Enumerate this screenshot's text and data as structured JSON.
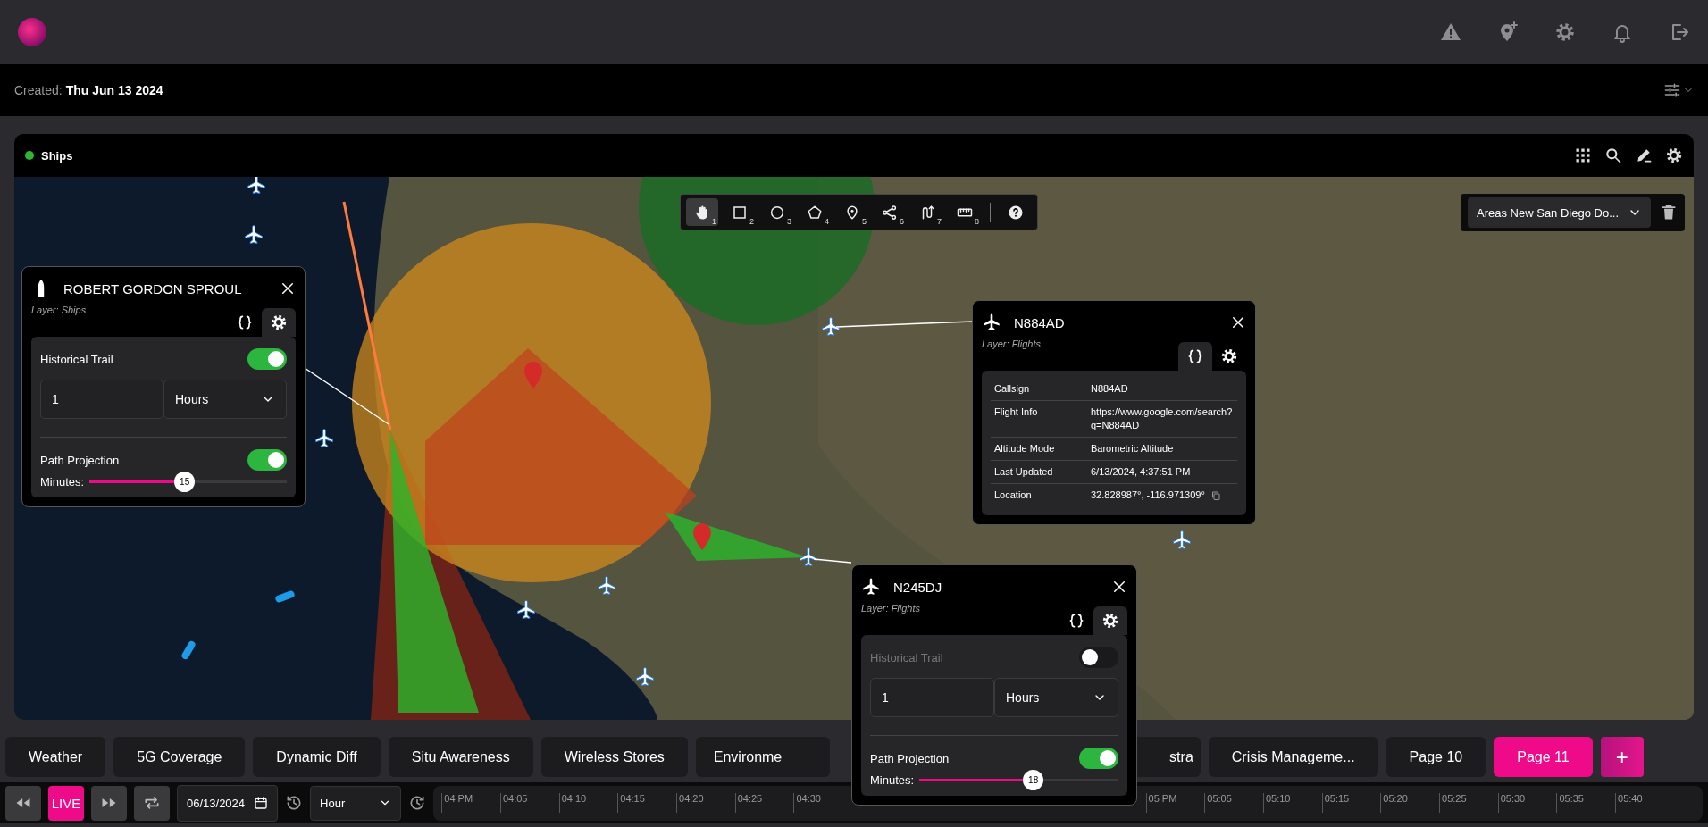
{
  "created": {
    "label": "Created:",
    "value": "Thu Jun 13 2024"
  },
  "panel": {
    "title": "Ships"
  },
  "map": {
    "toolbar": [
      {
        "kind": "pan",
        "number": "1",
        "selected": true
      },
      {
        "kind": "rectangle",
        "number": "2",
        "selected": false
      },
      {
        "kind": "circle",
        "number": "3",
        "selected": false
      },
      {
        "kind": "polygon",
        "number": "4",
        "selected": false
      },
      {
        "kind": "point",
        "number": "5",
        "selected": false
      },
      {
        "kind": "network",
        "number": "6",
        "selected": false
      },
      {
        "kind": "path",
        "number": "7",
        "selected": false
      },
      {
        "kind": "measure",
        "number": "8",
        "selected": false
      },
      {
        "kind": "help",
        "selected": false
      }
    ],
    "area_select": {
      "value": "Areas New San Diego Do..."
    }
  },
  "popups": [
    {
      "kind": "ship",
      "title": "ROBERT GORDON SPROUL",
      "layer": "Layer: Ships",
      "tabs": [
        {
          "kind": "json",
          "selected": false
        },
        {
          "kind": "settings",
          "selected": true
        }
      ],
      "historical_trail": {
        "label": "Historical Trail",
        "on": true,
        "amount": "1",
        "unit": "Hours"
      },
      "path_projection": {
        "label": "Path Projection",
        "on": true,
        "minutes_label": "Minutes:",
        "level": 0.48,
        "reading": "15"
      }
    },
    {
      "kind": "plane",
      "title": "N884AD",
      "layer": "Layer: Flights",
      "tabs": [
        {
          "kind": "json",
          "selected": true
        },
        {
          "kind": "settings",
          "selected": false
        }
      ],
      "details": [
        {
          "label": "Callsign",
          "value": "N884AD"
        },
        {
          "label": "Flight Info",
          "value": "https://www.google.com/search?q=N884AD"
        },
        {
          "label": "Altitude Mode",
          "value": "Barometric Altitude"
        },
        {
          "label": "Last Updated",
          "value": "6/13/2024, 4:37:51 PM"
        },
        {
          "label": "Location",
          "value": "32.828987°, -116.971309°",
          "copyable": true
        }
      ]
    },
    {
      "kind": "plane",
      "title": "N245DJ",
      "layer": "Layer: Flights",
      "tabs": [
        {
          "kind": "json",
          "selected": false
        },
        {
          "kind": "settings",
          "selected": true
        }
      ],
      "historical_trail": {
        "label": "Historical Trail",
        "on": false,
        "amount": "1",
        "unit": "Hours"
      },
      "path_projection": {
        "label": "Path Projection",
        "on": true,
        "minutes_label": "Minutes:",
        "level": 0.57,
        "reading": "18"
      }
    }
  ],
  "tabs": [
    {
      "label": "Weather",
      "selected": false,
      "kind": "full"
    },
    {
      "label": "5G Coverage",
      "selected": false,
      "kind": "full"
    },
    {
      "label": "Dynamic Diff",
      "selected": false,
      "kind": "full"
    },
    {
      "label": "Situ Awareness",
      "selected": false,
      "kind": "full"
    },
    {
      "label": "Wireless Stores",
      "selected": false,
      "kind": "full"
    },
    {
      "label": "Environme",
      "selected": false,
      "kind": "cut_right"
    },
    {
      "label": "stra",
      "selected": false,
      "kind": "cut_left"
    },
    {
      "label": "Crisis Manageme...",
      "selected": false,
      "kind": "full"
    },
    {
      "label": "Page 10",
      "selected": false,
      "kind": "full"
    },
    {
      "label": "Page 11",
      "selected": true,
      "kind": "full"
    }
  ],
  "add_tab": "+",
  "timeline": {
    "live": "LIVE",
    "date": "06/13/2024",
    "interval": "Hour",
    "ticks_before": [
      "04 PM",
      "04:05",
      "04:10",
      "04:15",
      "04:20",
      "04:25",
      "04:30"
    ],
    "ticks_after": [
      "05 PM",
      "05:05",
      "05:10",
      "05:15",
      "05:20",
      "05:25",
      "05:30",
      "05:35",
      "05:40"
    ]
  }
}
